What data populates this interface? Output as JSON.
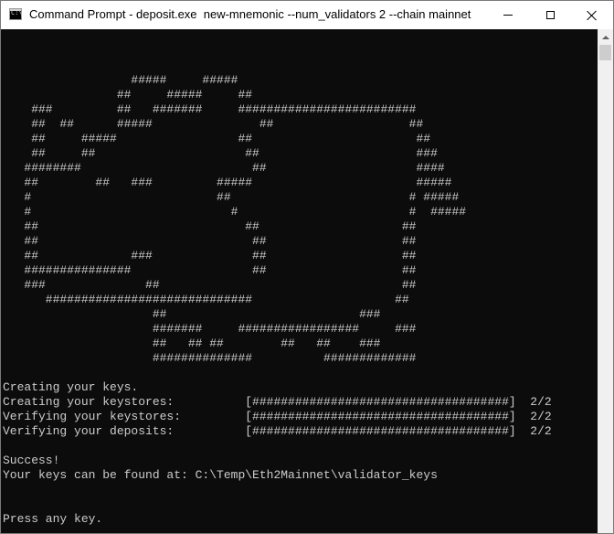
{
  "window": {
    "title": "Command Prompt - deposit.exe  new-mnemonic --num_validators 2 --chain mainnet",
    "icon": "cmd-icon",
    "icon_text": "C:\\"
  },
  "console": {
    "lines": [
      "",
      "                  #####     #####",
      "                ##     #####     ##",
      "    ###         ##   #######     #########################",
      "    ##  ##      #####               ##                   ##",
      "    ##     #####                 ##                       ##",
      "    ##     ##                     ##                      ###",
      "   ########                        ##                     ####",
      "   ##        ##   ###         #####                       #####",
      "   #                          ##                         # #####",
      "   #                            #                        #  #####",
      "   ##                             ##                    ##",
      "   ##                              ##                   ##",
      "   ##             ###              ##                   ##",
      "   ###############                 ##                   ##",
      "   ###              ##                                  ##",
      "      #############################                    ##",
      "                     ##                           ###",
      "                     #######     #################     ###",
      "                     ##   ## ##        ##   ##    ###",
      "                     ##############          #############",
      "",
      "Creating your keys.",
      "Creating your keystores:          [####################################]  2/2",
      "Verifying your keystores:         [####################################]  2/2",
      "Verifying your deposits:          [####################################]  2/2",
      "",
      "Success!",
      "Your keys can be found at: C:\\Temp\\Eth2Mainnet\\validator_keys",
      "",
      "",
      "Press any key."
    ]
  },
  "colors": {
    "console_bg": "#0c0c0c",
    "console_fg": "#cccccc",
    "titlebar_bg": "#ffffff"
  }
}
